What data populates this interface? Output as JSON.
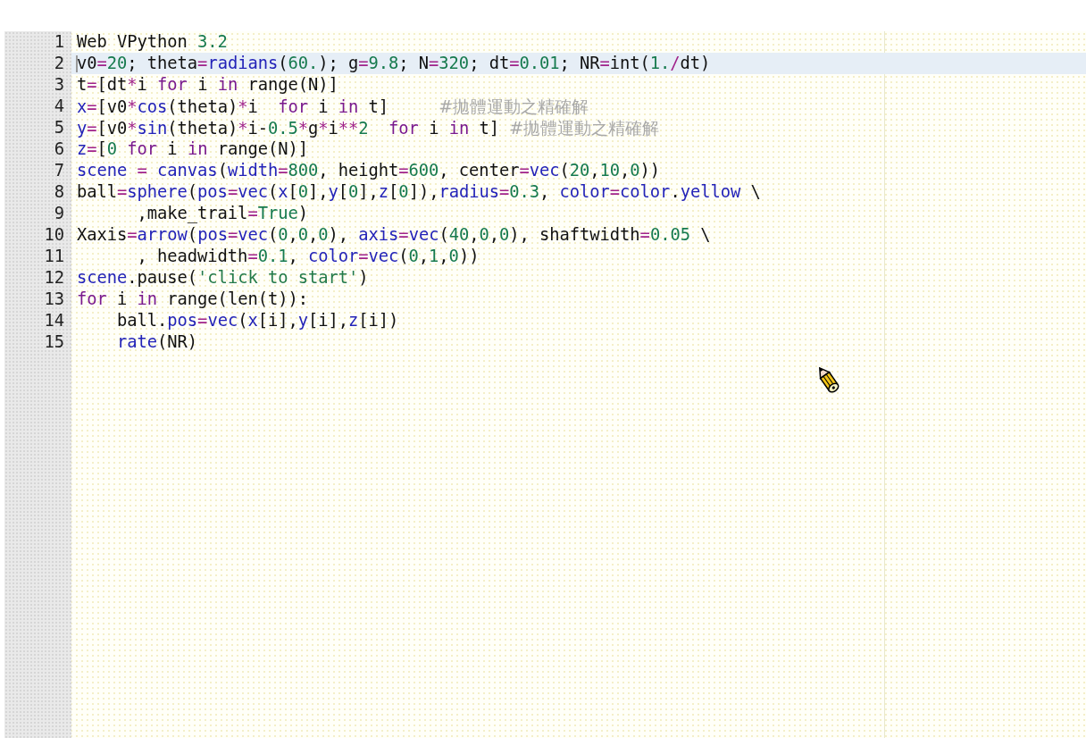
{
  "editor": {
    "lines": [
      {
        "number": "1",
        "selected": false,
        "tokens": [
          {
            "kind": "plain",
            "text": "Web VPython "
          },
          {
            "kind": "number",
            "text": "3.2"
          }
        ]
      },
      {
        "number": "2",
        "selected": true,
        "tokens": [
          {
            "kind": "plain",
            "text": "v0"
          },
          {
            "kind": "op",
            "text": "="
          },
          {
            "kind": "number",
            "text": "20"
          },
          {
            "kind": "plain",
            "text": "; theta"
          },
          {
            "kind": "op",
            "text": "="
          },
          {
            "kind": "name",
            "text": "radians"
          },
          {
            "kind": "plain",
            "text": "("
          },
          {
            "kind": "number",
            "text": "60."
          },
          {
            "kind": "plain",
            "text": "); g"
          },
          {
            "kind": "op",
            "text": "="
          },
          {
            "kind": "number",
            "text": "9.8"
          },
          {
            "kind": "plain",
            "text": "; N"
          },
          {
            "kind": "op",
            "text": "="
          },
          {
            "kind": "number",
            "text": "320"
          },
          {
            "kind": "plain",
            "text": "; dt"
          },
          {
            "kind": "op",
            "text": "="
          },
          {
            "kind": "number",
            "text": "0.01"
          },
          {
            "kind": "plain",
            "text": "; NR"
          },
          {
            "kind": "op",
            "text": "="
          },
          {
            "kind": "plain",
            "text": "int("
          },
          {
            "kind": "number",
            "text": "1."
          },
          {
            "kind": "op",
            "text": "/"
          },
          {
            "kind": "plain",
            "text": "dt)"
          }
        ]
      },
      {
        "number": "3",
        "selected": false,
        "tokens": [
          {
            "kind": "plain",
            "text": "t"
          },
          {
            "kind": "op",
            "text": "="
          },
          {
            "kind": "plain",
            "text": "[dt"
          },
          {
            "kind": "op",
            "text": "*"
          },
          {
            "kind": "plain",
            "text": "i "
          },
          {
            "kind": "keyword",
            "text": "for"
          },
          {
            "kind": "plain",
            "text": " i "
          },
          {
            "kind": "keyword",
            "text": "in"
          },
          {
            "kind": "plain",
            "text": " range(N)]"
          }
        ]
      },
      {
        "number": "4",
        "selected": false,
        "tokens": [
          {
            "kind": "name",
            "text": "x"
          },
          {
            "kind": "op",
            "text": "="
          },
          {
            "kind": "plain",
            "text": "[v0"
          },
          {
            "kind": "op",
            "text": "*"
          },
          {
            "kind": "name",
            "text": "cos"
          },
          {
            "kind": "plain",
            "text": "(theta)"
          },
          {
            "kind": "op",
            "text": "*"
          },
          {
            "kind": "plain",
            "text": "i  "
          },
          {
            "kind": "keyword",
            "text": "for"
          },
          {
            "kind": "plain",
            "text": " i "
          },
          {
            "kind": "keyword",
            "text": "in"
          },
          {
            "kind": "plain",
            "text": " t]     "
          },
          {
            "kind": "comment",
            "text": "#拋體運動之精確解"
          }
        ]
      },
      {
        "number": "5",
        "selected": false,
        "tokens": [
          {
            "kind": "name",
            "text": "y"
          },
          {
            "kind": "op",
            "text": "="
          },
          {
            "kind": "plain",
            "text": "[v0"
          },
          {
            "kind": "op",
            "text": "*"
          },
          {
            "kind": "name",
            "text": "sin"
          },
          {
            "kind": "plain",
            "text": "(theta)"
          },
          {
            "kind": "op",
            "text": "*"
          },
          {
            "kind": "plain",
            "text": "i-"
          },
          {
            "kind": "number",
            "text": "0.5"
          },
          {
            "kind": "op",
            "text": "*"
          },
          {
            "kind": "plain",
            "text": "g"
          },
          {
            "kind": "op",
            "text": "*"
          },
          {
            "kind": "plain",
            "text": "i"
          },
          {
            "kind": "op",
            "text": "**"
          },
          {
            "kind": "number",
            "text": "2"
          },
          {
            "kind": "keyword",
            "text": "  for"
          },
          {
            "kind": "plain",
            "text": " i "
          },
          {
            "kind": "keyword",
            "text": "in"
          },
          {
            "kind": "plain",
            "text": " t] "
          },
          {
            "kind": "comment",
            "text": "#拋體運動之精確解"
          }
        ]
      },
      {
        "number": "6",
        "selected": false,
        "tokens": [
          {
            "kind": "name",
            "text": "z"
          },
          {
            "kind": "op",
            "text": "="
          },
          {
            "kind": "plain",
            "text": "["
          },
          {
            "kind": "number",
            "text": "0"
          },
          {
            "kind": "keyword",
            "text": " for"
          },
          {
            "kind": "plain",
            "text": " i "
          },
          {
            "kind": "keyword",
            "text": "in"
          },
          {
            "kind": "plain",
            "text": " range(N)]"
          }
        ]
      },
      {
        "number": "7",
        "selected": false,
        "tokens": [
          {
            "kind": "name",
            "text": "scene"
          },
          {
            "kind": "op",
            "text": " = "
          },
          {
            "kind": "name",
            "text": "canvas"
          },
          {
            "kind": "plain",
            "text": "("
          },
          {
            "kind": "name",
            "text": "width"
          },
          {
            "kind": "op",
            "text": "="
          },
          {
            "kind": "number",
            "text": "800"
          },
          {
            "kind": "plain",
            "text": ", height"
          },
          {
            "kind": "op",
            "text": "="
          },
          {
            "kind": "number",
            "text": "600"
          },
          {
            "kind": "plain",
            "text": ", center"
          },
          {
            "kind": "op",
            "text": "="
          },
          {
            "kind": "name",
            "text": "vec"
          },
          {
            "kind": "plain",
            "text": "("
          },
          {
            "kind": "number",
            "text": "20"
          },
          {
            "kind": "plain",
            "text": ","
          },
          {
            "kind": "number",
            "text": "10"
          },
          {
            "kind": "plain",
            "text": ","
          },
          {
            "kind": "number",
            "text": "0"
          },
          {
            "kind": "plain",
            "text": "))"
          }
        ]
      },
      {
        "number": "8",
        "selected": false,
        "tokens": [
          {
            "kind": "plain",
            "text": "ball"
          },
          {
            "kind": "op",
            "text": "="
          },
          {
            "kind": "name",
            "text": "sphere"
          },
          {
            "kind": "plain",
            "text": "("
          },
          {
            "kind": "name",
            "text": "pos"
          },
          {
            "kind": "op",
            "text": "="
          },
          {
            "kind": "name",
            "text": "vec"
          },
          {
            "kind": "plain",
            "text": "("
          },
          {
            "kind": "name",
            "text": "x"
          },
          {
            "kind": "plain",
            "text": "["
          },
          {
            "kind": "number",
            "text": "0"
          },
          {
            "kind": "plain",
            "text": "],"
          },
          {
            "kind": "name",
            "text": "y"
          },
          {
            "kind": "plain",
            "text": "["
          },
          {
            "kind": "number",
            "text": "0"
          },
          {
            "kind": "plain",
            "text": "],"
          },
          {
            "kind": "name",
            "text": "z"
          },
          {
            "kind": "plain",
            "text": "["
          },
          {
            "kind": "number",
            "text": "0"
          },
          {
            "kind": "plain",
            "text": "]),"
          },
          {
            "kind": "name",
            "text": "radius"
          },
          {
            "kind": "op",
            "text": "="
          },
          {
            "kind": "number",
            "text": "0.3"
          },
          {
            "kind": "plain",
            "text": ", "
          },
          {
            "kind": "name",
            "text": "color"
          },
          {
            "kind": "op",
            "text": "="
          },
          {
            "kind": "name",
            "text": "color"
          },
          {
            "kind": "plain",
            "text": "."
          },
          {
            "kind": "name",
            "text": "yellow"
          },
          {
            "kind": "plain",
            "text": " \\"
          }
        ]
      },
      {
        "number": "9",
        "selected": false,
        "tokens": [
          {
            "kind": "plain",
            "text": "      ,make_trail"
          },
          {
            "kind": "op",
            "text": "="
          },
          {
            "kind": "number",
            "text": "True"
          },
          {
            "kind": "plain",
            "text": ")"
          }
        ]
      },
      {
        "number": "10",
        "selected": false,
        "tokens": [
          {
            "kind": "plain",
            "text": "Xaxis"
          },
          {
            "kind": "op",
            "text": "="
          },
          {
            "kind": "name",
            "text": "arrow"
          },
          {
            "kind": "plain",
            "text": "("
          },
          {
            "kind": "name",
            "text": "pos"
          },
          {
            "kind": "op",
            "text": "="
          },
          {
            "kind": "name",
            "text": "vec"
          },
          {
            "kind": "plain",
            "text": "("
          },
          {
            "kind": "number",
            "text": "0"
          },
          {
            "kind": "plain",
            "text": ","
          },
          {
            "kind": "number",
            "text": "0"
          },
          {
            "kind": "plain",
            "text": ","
          },
          {
            "kind": "number",
            "text": "0"
          },
          {
            "kind": "plain",
            "text": "), "
          },
          {
            "kind": "name",
            "text": "axis"
          },
          {
            "kind": "op",
            "text": "="
          },
          {
            "kind": "name",
            "text": "vec"
          },
          {
            "kind": "plain",
            "text": "("
          },
          {
            "kind": "number",
            "text": "40"
          },
          {
            "kind": "plain",
            "text": ","
          },
          {
            "kind": "number",
            "text": "0"
          },
          {
            "kind": "plain",
            "text": ","
          },
          {
            "kind": "number",
            "text": "0"
          },
          {
            "kind": "plain",
            "text": "), shaftwidth"
          },
          {
            "kind": "op",
            "text": "="
          },
          {
            "kind": "number",
            "text": "0.05"
          },
          {
            "kind": "plain",
            "text": " \\"
          }
        ]
      },
      {
        "number": "11",
        "selected": false,
        "tokens": [
          {
            "kind": "plain",
            "text": "      , headwidth"
          },
          {
            "kind": "op",
            "text": "="
          },
          {
            "kind": "number",
            "text": "0.1"
          },
          {
            "kind": "plain",
            "text": ", "
          },
          {
            "kind": "name",
            "text": "color"
          },
          {
            "kind": "op",
            "text": "="
          },
          {
            "kind": "name",
            "text": "vec"
          },
          {
            "kind": "plain",
            "text": "("
          },
          {
            "kind": "number",
            "text": "0"
          },
          {
            "kind": "plain",
            "text": ","
          },
          {
            "kind": "number",
            "text": "1"
          },
          {
            "kind": "plain",
            "text": ","
          },
          {
            "kind": "number",
            "text": "0"
          },
          {
            "kind": "plain",
            "text": "))"
          }
        ]
      },
      {
        "number": "12",
        "selected": false,
        "tokens": [
          {
            "kind": "name",
            "text": "scene"
          },
          {
            "kind": "plain",
            "text": ".pause("
          },
          {
            "kind": "string",
            "text": "'click to start'"
          },
          {
            "kind": "plain",
            "text": ")"
          }
        ]
      },
      {
        "number": "13",
        "selected": false,
        "tokens": [
          {
            "kind": "keyword",
            "text": "for"
          },
          {
            "kind": "plain",
            "text": " i "
          },
          {
            "kind": "keyword",
            "text": "in"
          },
          {
            "kind": "plain",
            "text": " range(len(t)):"
          }
        ]
      },
      {
        "number": "14",
        "selected": false,
        "tokens": [
          {
            "kind": "plain",
            "text": "    ball."
          },
          {
            "kind": "name",
            "text": "pos"
          },
          {
            "kind": "op",
            "text": "="
          },
          {
            "kind": "name",
            "text": "vec"
          },
          {
            "kind": "plain",
            "text": "("
          },
          {
            "kind": "name",
            "text": "x"
          },
          {
            "kind": "plain",
            "text": "[i],"
          },
          {
            "kind": "name",
            "text": "y"
          },
          {
            "kind": "plain",
            "text": "[i],"
          },
          {
            "kind": "name",
            "text": "z"
          },
          {
            "kind": "plain",
            "text": "[i])"
          }
        ]
      },
      {
        "number": "15",
        "selected": false,
        "tokens": [
          {
            "kind": "name",
            "text": "    rate"
          },
          {
            "kind": "plain",
            "text": "(NR)"
          }
        ]
      }
    ]
  }
}
